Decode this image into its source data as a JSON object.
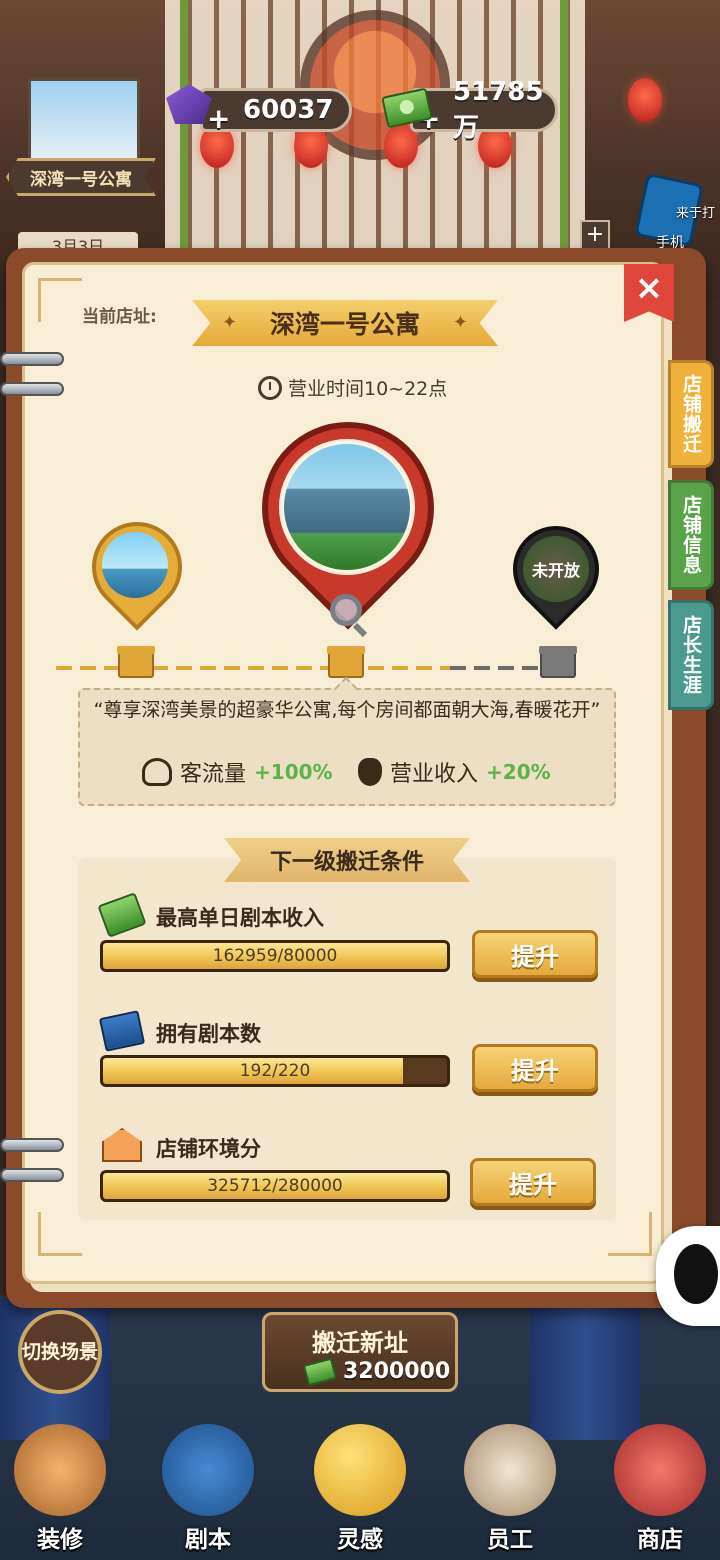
{
  "hud": {
    "gems": "60037",
    "money": "51785万",
    "plus": "+",
    "shop_name": "深湾一号公寓",
    "date": "3月3日",
    "phone_hint": "来于打",
    "phone_label": "手机"
  },
  "panel": {
    "address_label": "当前店址:",
    "title": "深湾一号公寓",
    "hours": "营业时间10~22点",
    "locked_label": "未开放",
    "close_icon": "×",
    "description": "“尊享深湾美景的超豪华公寓,每个房间都面朝大海,春暖花开”",
    "stats": [
      {
        "label": "客流量",
        "bonus": "+100%",
        "icon": "people-icon"
      },
      {
        "label": "营业收入",
        "bonus": "+20%",
        "icon": "money-bag-icon"
      }
    ],
    "conditions_title": "下一级搬迁条件",
    "conditions": [
      {
        "label": "最高单日剧本收入",
        "progress": "162959/80000",
        "fill": 1.0,
        "button": "提升",
        "icon": "cash-icon"
      },
      {
        "label": "拥有剧本数",
        "progress": "192/220",
        "fill": 0.873,
        "button": "提升",
        "icon": "book-icon"
      },
      {
        "label": "店铺环境分",
        "progress": "325712/280000",
        "fill": 1.0,
        "button": "提升",
        "icon": "house-icon"
      }
    ]
  },
  "side_tabs": [
    {
      "label": "店铺搬迁",
      "color": "#f0b23a"
    },
    {
      "label": "店铺信息",
      "color": "#5aa34a"
    },
    {
      "label": "店长生涯",
      "color": "#4a9a8e"
    }
  ],
  "bottom": {
    "relocate_title": "搬迁新址",
    "relocate_cost": "3200000",
    "switch_scene": "切换场景",
    "nav": [
      "装修",
      "剧本",
      "灵感",
      "员工",
      "商店"
    ]
  }
}
